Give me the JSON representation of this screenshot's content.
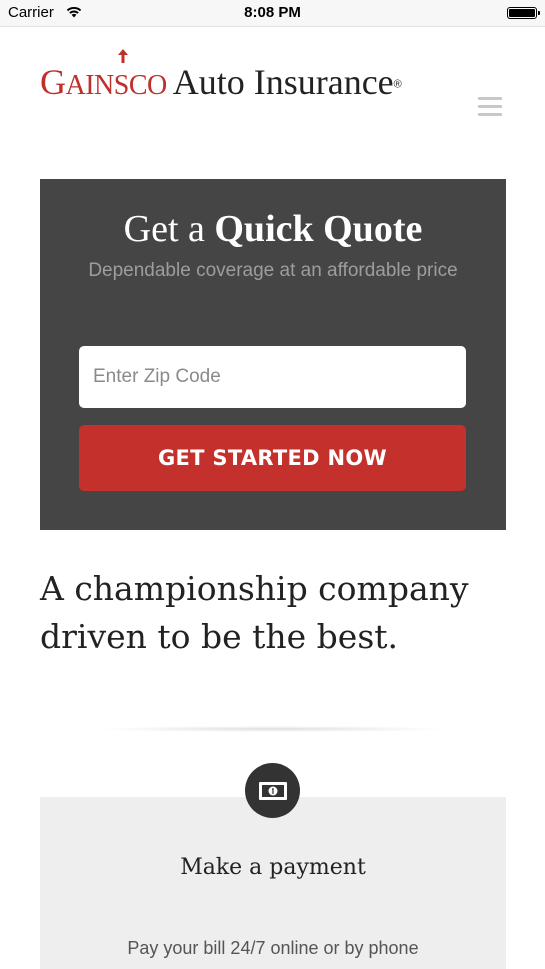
{
  "status_bar": {
    "carrier": "Carrier",
    "time": "8:08 PM"
  },
  "header": {
    "logo_brand_first": "G",
    "logo_brand_rest": "AINSCO",
    "logo_product": "Auto Insurance",
    "logo_reg": "®",
    "menu_icon": "hamburger-icon"
  },
  "quote": {
    "title_light": "Get a ",
    "title_bold": "Quick Quote",
    "subtitle": "Dependable coverage at an affordable price",
    "zip_placeholder": "Enter Zip Code",
    "zip_value": "",
    "button_label": "GET STARTED NOW"
  },
  "tagline": "A championship company driven to be the best.",
  "payment": {
    "icon": "money-bill-icon",
    "title": "Make a payment",
    "description": "Pay your bill 24/7 online or by phone"
  },
  "colors": {
    "brand_red": "#c4302b",
    "quote_bg": "#454545",
    "card_bg": "#eeeeee"
  }
}
